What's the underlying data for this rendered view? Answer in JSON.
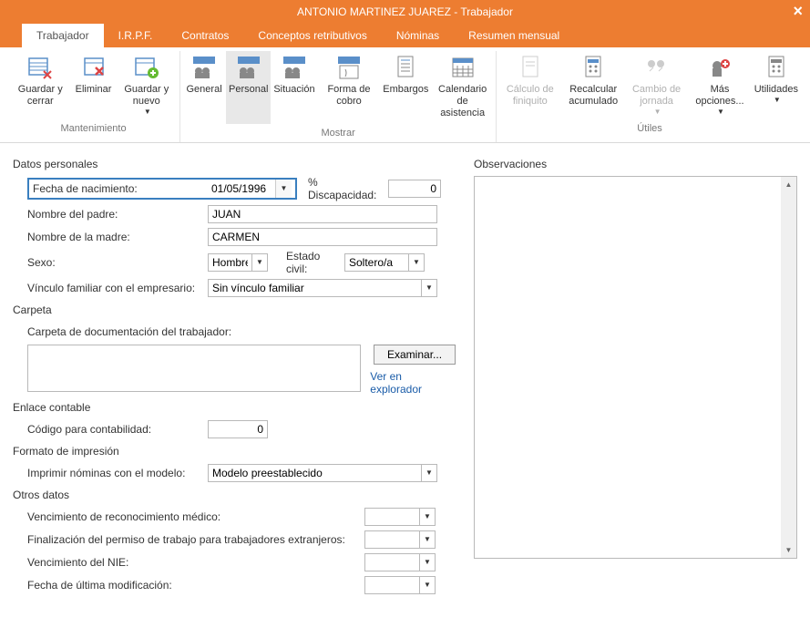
{
  "window": {
    "title": "ANTONIO MARTINEZ JUAREZ - Trabajador"
  },
  "tabs": {
    "trabajador": "Trabajador",
    "irpf": "I.R.P.F.",
    "contratos": "Contratos",
    "conceptos": "Conceptos retributivos",
    "nominas": "Nóminas",
    "resumen": "Resumen mensual"
  },
  "ribbon": {
    "guardar_cerrar": "Guardar y cerrar",
    "eliminar": "Eliminar",
    "guardar_nuevo": "Guardar y nuevo",
    "general": "General",
    "personal": "Personal",
    "situacion": "Situación",
    "forma_cobro": "Forma de cobro",
    "embargos": "Embargos",
    "calendario": "Calendario de asistencia",
    "calculo_finiquito": "Cálculo de finiquito",
    "recalcular": "Recalcular acumulado",
    "cambio_jornada": "Cambio de jornada",
    "mas_opciones": "Más opciones...",
    "utilidades": "Utilidades",
    "group_mantenimiento": "Mantenimiento",
    "group_mostrar": "Mostrar",
    "group_utiles": "Útiles"
  },
  "sections": {
    "datos_personales": "Datos personales",
    "carpeta": "Carpeta",
    "enlace_contable": "Enlace contable",
    "formato_impresion": "Formato de impresión",
    "otros_datos": "Otros datos",
    "observaciones": "Observaciones"
  },
  "labels": {
    "fecha_nacimiento": "Fecha de nacimiento:",
    "discapacidad": "% Discapacidad:",
    "nombre_padre": "Nombre del padre:",
    "nombre_madre": "Nombre de la madre:",
    "sexo": "Sexo:",
    "estado_civil": "Estado civil:",
    "vinculo": "Vínculo familiar con el empresario:",
    "carpeta_doc": "Carpeta de documentación del trabajador:",
    "examinar": "Examinar...",
    "ver_explorador": "Ver en explorador",
    "codigo_contabilidad": "Código para contabilidad:",
    "imprimir_modelo": "Imprimir nóminas con el modelo:",
    "vencimiento_medico": "Vencimiento de reconocimiento médico:",
    "finalizacion_permiso": "Finalización del permiso de trabajo para trabajadores extranjeros:",
    "vencimiento_nie": "Vencimiento del NIE:",
    "fecha_modificacion": "Fecha de última modificación:"
  },
  "values": {
    "fecha_nacimiento": "01/05/1996",
    "discapacidad": "0",
    "nombre_padre": "JUAN",
    "nombre_madre": "CARMEN",
    "sexo": "Hombre",
    "estado_civil": "Soltero/a",
    "vinculo": "Sin vínculo familiar",
    "carpeta_doc": "",
    "codigo_contabilidad": "0",
    "imprimir_modelo": "Modelo preestablecido",
    "vencimiento_medico": "",
    "finalizacion_permiso": "",
    "vencimiento_nie": "",
    "fecha_modificacion": ""
  }
}
